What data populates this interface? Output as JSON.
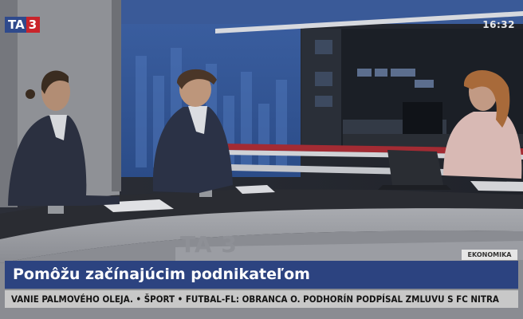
{
  "channel_logo": {
    "ta": "TA",
    "num": "3"
  },
  "clock": "16:32",
  "desk_logo": "TA 3",
  "section_tag": "EKONOMIKA",
  "headline": "Pomôžu začínajúcim podnikateľom",
  "ticker": "VANIE PALMOVÉHO OLEJA.  •  ŠPORT  •  FUTBAL-FL: OBRANCA O. PODHORÍN PODPÍSAL ZMLUVU S FC NITRA",
  "colors": {
    "brand_blue": "#2c4380",
    "brand_red": "#c9242b",
    "ticker_bg": "#c8c8c8"
  }
}
